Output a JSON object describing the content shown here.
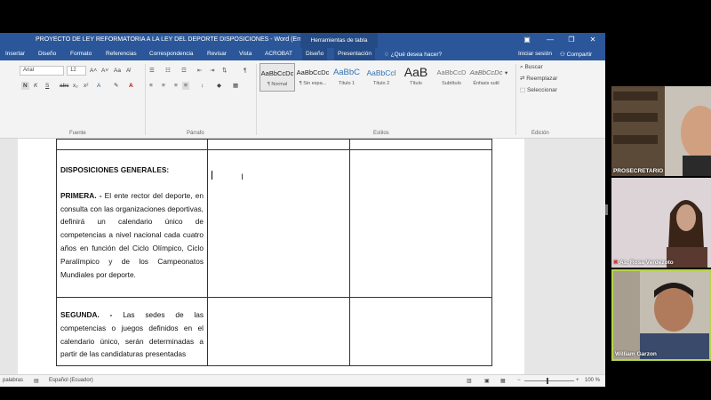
{
  "window": {
    "title": "PROYECTO DE LEY REFORMATORIA A LA LEY DEL DEPORTE DISPOSICIONES - Word (Error de activac...",
    "context_tab": "Herramientas de tabla"
  },
  "tabs": {
    "items": [
      "Insertar",
      "Diseño",
      "Formato",
      "Referencias",
      "Correspondencia",
      "Revisar",
      "Vista",
      "ACROBAT",
      "Diseño",
      "Presentación"
    ],
    "tell_me": "¿Qué desea hacer?",
    "sign_in": "Iniciar sesión",
    "share": "Compartir"
  },
  "ribbon": {
    "font_name": "Arial",
    "font_size": "12",
    "groups": [
      "Fuente",
      "Párrafo",
      "Estilos",
      "Edición"
    ],
    "styles": [
      {
        "preview": "AaBbCcDc",
        "name": "¶ Normal"
      },
      {
        "preview": "AaBbCcDc",
        "name": "¶ Sin espa..."
      },
      {
        "preview": "AaBbC",
        "name": "Título 1"
      },
      {
        "preview": "AaBbCcl",
        "name": "Título 2"
      },
      {
        "preview": "AaB",
        "name": "Título"
      },
      {
        "preview": "AaBbCcD",
        "name": "Subtítulo"
      },
      {
        "preview": "AaBbCcDc",
        "name": "Énfasis sutil"
      }
    ],
    "editing": {
      "find": "Buscar",
      "replace": "Reemplazar",
      "select": "Seleccionar"
    },
    "format_buttons": {
      "bold": "N",
      "italic": "K",
      "underline": "S",
      "strike": "abc",
      "sub": "x₂",
      "sup": "x²"
    }
  },
  "document": {
    "heading": "DISPOSICIONES GENERALES:",
    "rows": [
      {
        "label": "PRIMERA. -",
        "text": " El ente rector del deporte, en consulta con las organizaciones deportivas, definirá un calendario único de competencias a nivel nacional cada cuatro años en función del Ciclo Olímpico, Ciclo Paralímpico y de los Campeonatos Mundiales por deporte."
      },
      {
        "label": "SEGUNDA. -",
        "text": " Las sedes de las competencias o juegos definidos en el calendario único, serán determinadas a partir de las candidaturas presentadas"
      }
    ]
  },
  "statusbar": {
    "words": "palabras",
    "language": "Español (Ecuador)",
    "zoom": "100 %"
  },
  "participants": [
    {
      "name": "PROSECRETARIO",
      "muted": false
    },
    {
      "name": "As. Rosa Verdezoto",
      "muted": true
    },
    {
      "name": "William Garzon",
      "muted": false
    }
  ]
}
